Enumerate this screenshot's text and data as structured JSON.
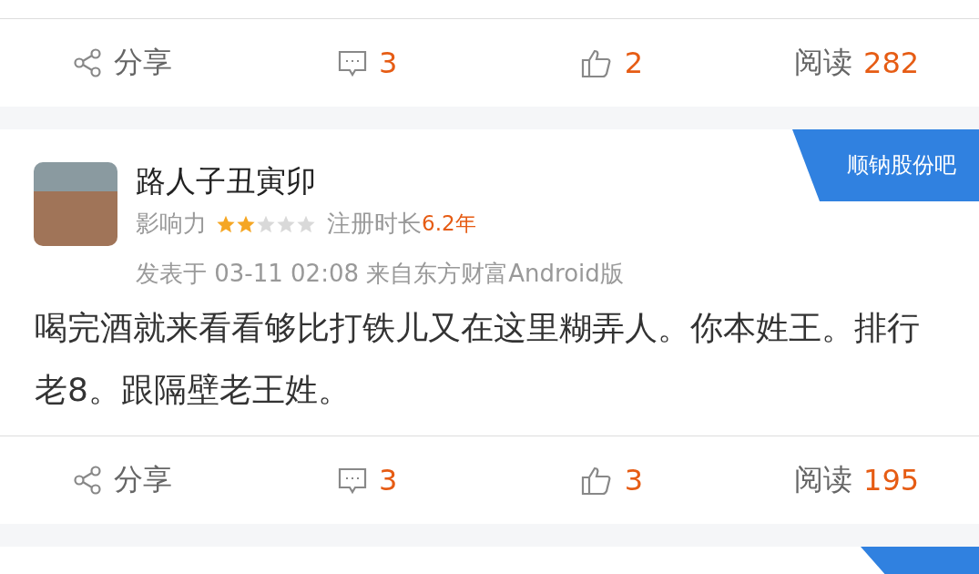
{
  "posts": [
    {
      "actions": {
        "share": "分享",
        "comments": "3",
        "likes": "2",
        "read_label": "阅读",
        "reads": "282"
      }
    },
    {
      "tag": "顺钠股份吧",
      "username": "路人子丑寅卯",
      "influence_label": "影响力",
      "stars": 2,
      "registered_label": "注册时长",
      "registered_value": "6.2年",
      "meta": "发表于 03-11 02:08  来自东方财富Android版",
      "body": "喝完酒就来看看够比打铁儿又在这里糊弄人。你本姓王。排行老8。跟隔壁老王姓。",
      "actions": {
        "share": "分享",
        "comments": "3",
        "likes": "3",
        "read_label": "阅读",
        "reads": "195"
      }
    }
  ]
}
